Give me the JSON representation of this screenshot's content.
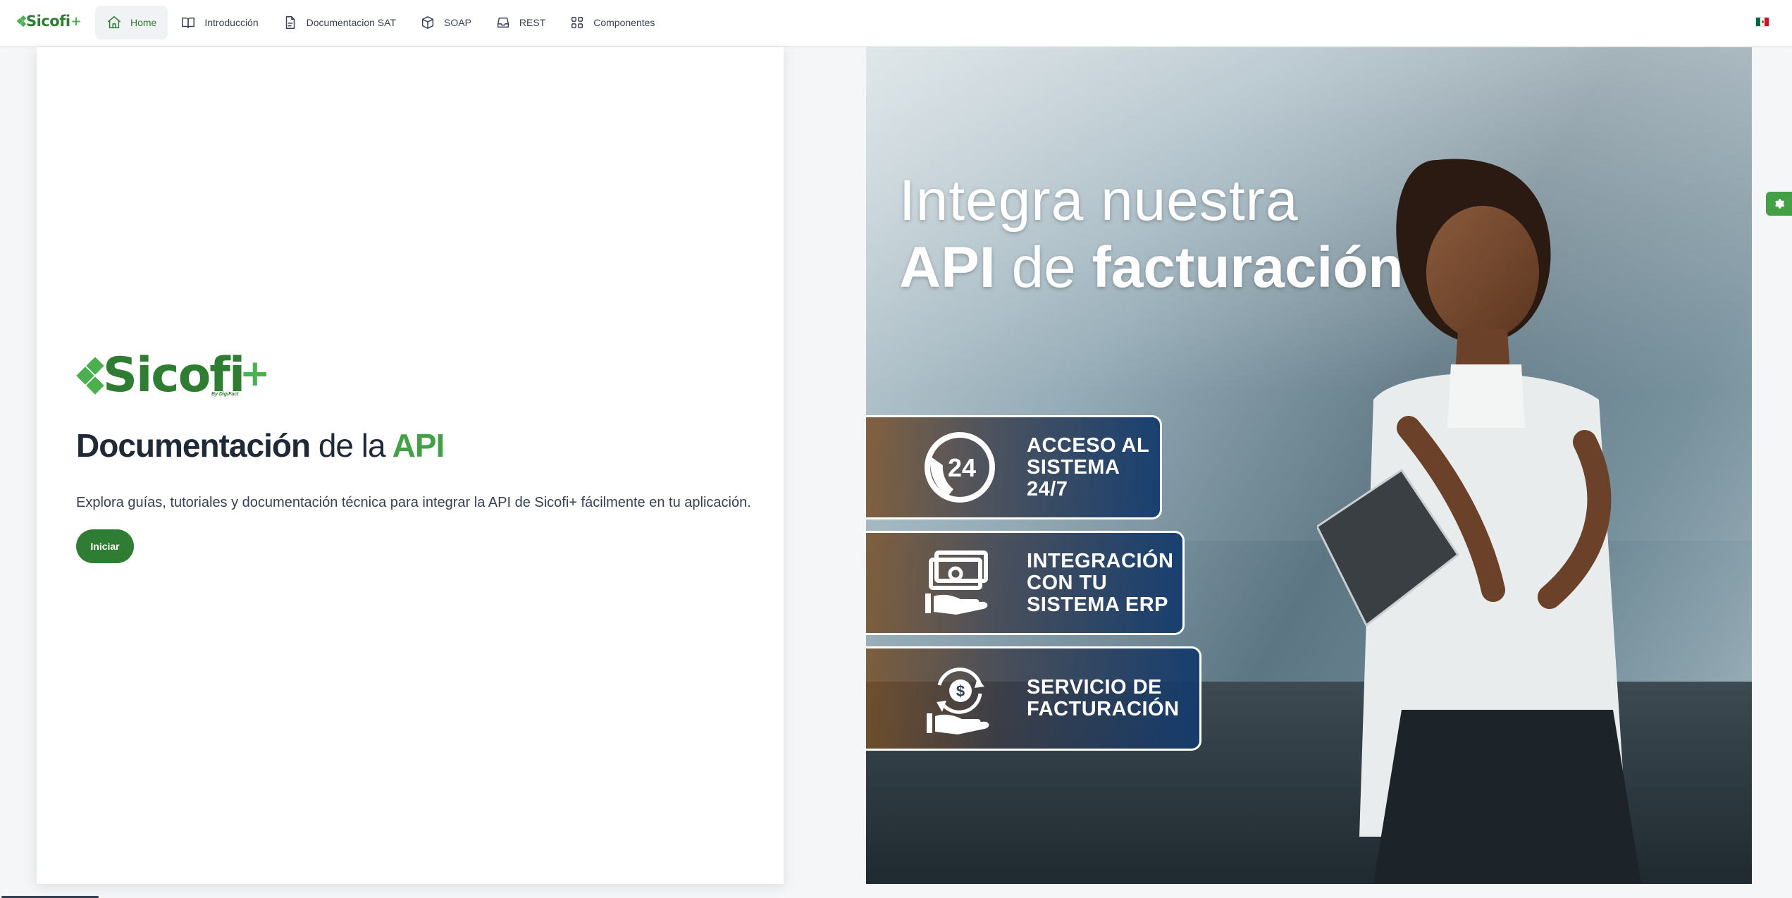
{
  "brand": {
    "name": "Sicofi",
    "plus": "+"
  },
  "nav": {
    "items": [
      {
        "label": "Home",
        "icon": "home-icon",
        "active": true
      },
      {
        "label": "Introducción",
        "icon": "book-open-icon",
        "active": false
      },
      {
        "label": "Documentacion SAT",
        "icon": "file-text-icon",
        "active": false
      },
      {
        "label": "SOAP",
        "icon": "box-icon",
        "active": false
      },
      {
        "label": "REST",
        "icon": "inbox-icon",
        "active": false
      },
      {
        "label": "Componentes",
        "icon": "grid-icon",
        "active": false
      }
    ],
    "language_flag": "mexico-flag-icon"
  },
  "hero_card": {
    "logo_text": "Sicofi",
    "logo_plus": "+",
    "logo_subtitle": "By DigiFact",
    "title_bold": "Documentación",
    "title_mid": "de la",
    "title_accent": "API",
    "description": "Explora guías, tutoriales y documentación técnica para integrar la API de Sicofi+ fácilmente en tu aplicación.",
    "cta_label": "Iniciar"
  },
  "banner": {
    "line1": "Integra nuestra",
    "line2_bold_a": "API",
    "line2_normal": "de",
    "line2_bold_b": "facturación",
    "features": [
      {
        "icon": "phone-24-icon",
        "icon_text": "24",
        "text": "ACCESO AL\nSISTEMA 24/7"
      },
      {
        "icon": "money-hand-icon",
        "text": "INTEGRACIÓN\nCON TU\nSISTEMA ERP"
      },
      {
        "icon": "dollar-cycle-hand-icon",
        "text": "SERVICIO DE\nFACTURACIÓN"
      }
    ]
  },
  "colors": {
    "brand_green": "#2e7d32",
    "accent_green": "#43a047",
    "text_dark": "#1f2937",
    "background": "#f4f6f8"
  },
  "settings_tab_icon": "gear-icon"
}
